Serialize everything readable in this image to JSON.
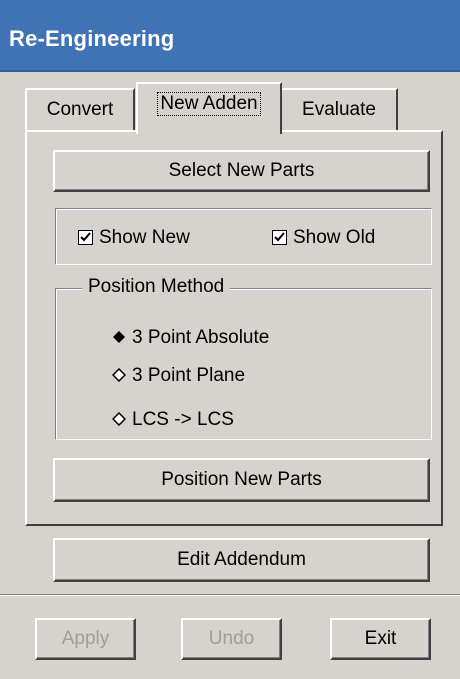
{
  "window": {
    "title": "Re-Engineering"
  },
  "tabs": [
    {
      "label": "Convert",
      "active": false
    },
    {
      "label": "New Adden",
      "active": true
    },
    {
      "label": "Evaluate",
      "active": false
    }
  ],
  "panel": {
    "select_button": "Select New Parts",
    "show_new": {
      "label": "Show New",
      "checked": true
    },
    "show_old": {
      "label": "Show Old",
      "checked": true
    },
    "position_method": {
      "title": "Position Method",
      "options": [
        {
          "label": "3 Point Absolute",
          "selected": true
        },
        {
          "label": "3 Point Plane",
          "selected": false
        },
        {
          "label": "LCS -> LCS",
          "selected": false
        }
      ]
    },
    "position_button": "Position New Parts"
  },
  "edit_addendum_button": "Edit Addendum",
  "footer": {
    "apply": {
      "label": "Apply",
      "enabled": false
    },
    "undo": {
      "label": "Undo",
      "enabled": false
    },
    "exit": {
      "label": "Exit",
      "enabled": true
    }
  },
  "colors": {
    "titlebar": "#3f73b5",
    "face": "#d6d3ce"
  }
}
